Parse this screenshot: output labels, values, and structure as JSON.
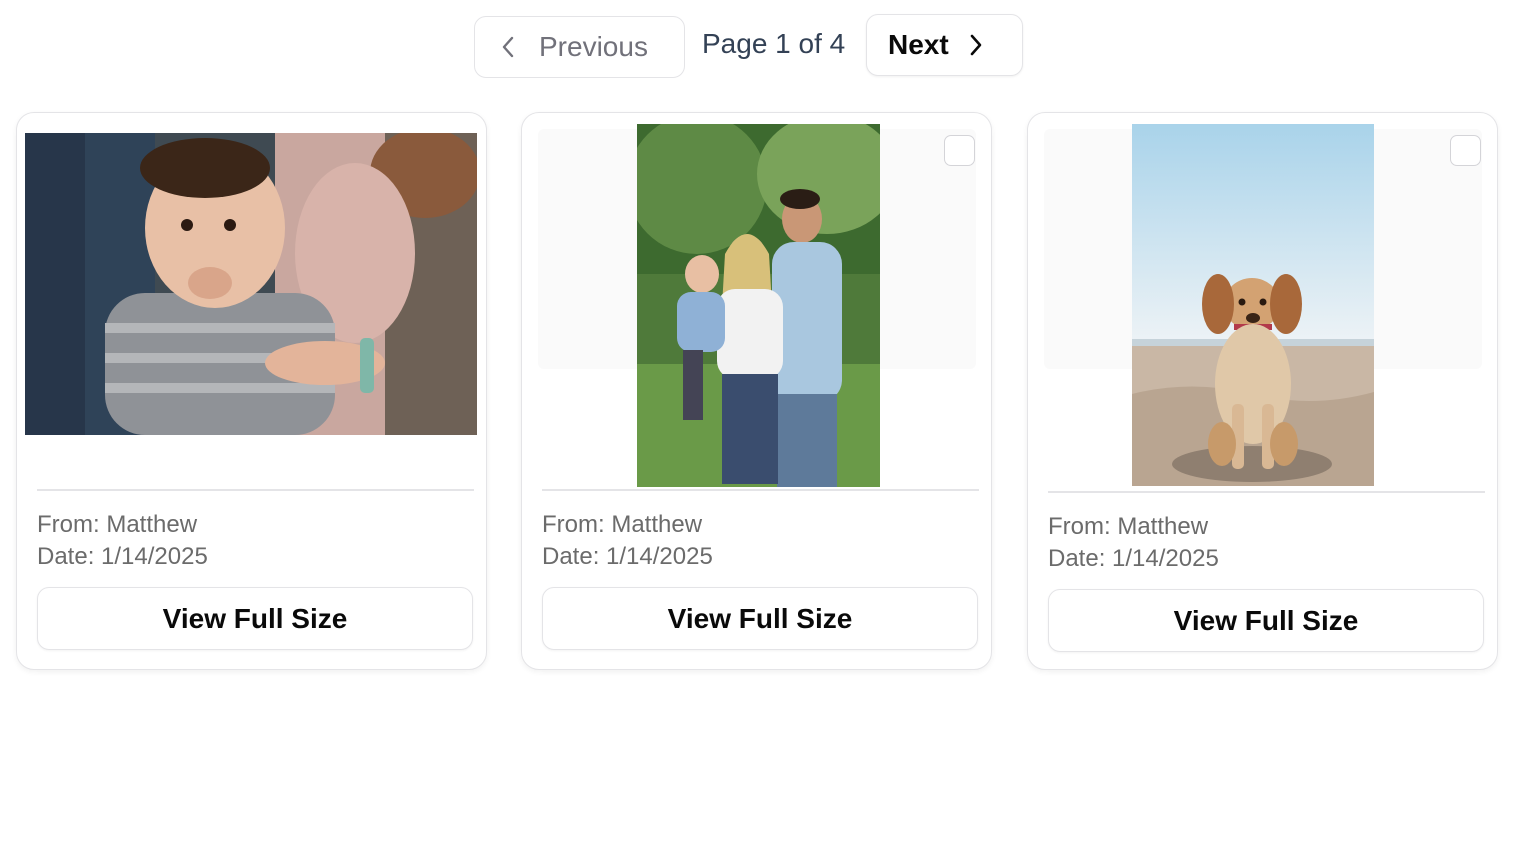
{
  "pagination": {
    "previous_label": "Previous",
    "page_indicator": "Page 1 of 4",
    "next_label": "Next",
    "current_page": 1,
    "total_pages": 4
  },
  "cards": [
    {
      "from": "From: Matthew",
      "date": "Date: 1/14/2025",
      "button_label": "View Full Size",
      "photo_subject": "baby-photo",
      "has_checkbox": false
    },
    {
      "from": "From: Matthew",
      "date": "Date: 1/14/2025",
      "button_label": "View Full Size",
      "photo_subject": "family-photo",
      "has_checkbox": true
    },
    {
      "from": "From: Matthew",
      "date": "Date: 1/14/2025",
      "button_label": "View Full Size",
      "photo_subject": "dog-on-beach-photo",
      "has_checkbox": true
    }
  ],
  "icons": {
    "previous": "chevron-left-icon",
    "next": "chevron-right-icon"
  },
  "colors": {
    "border": "#e4e4e7",
    "muted_text": "#6b6b6b",
    "disabled_text": "#71717a",
    "page_indicator_text": "#334155"
  }
}
